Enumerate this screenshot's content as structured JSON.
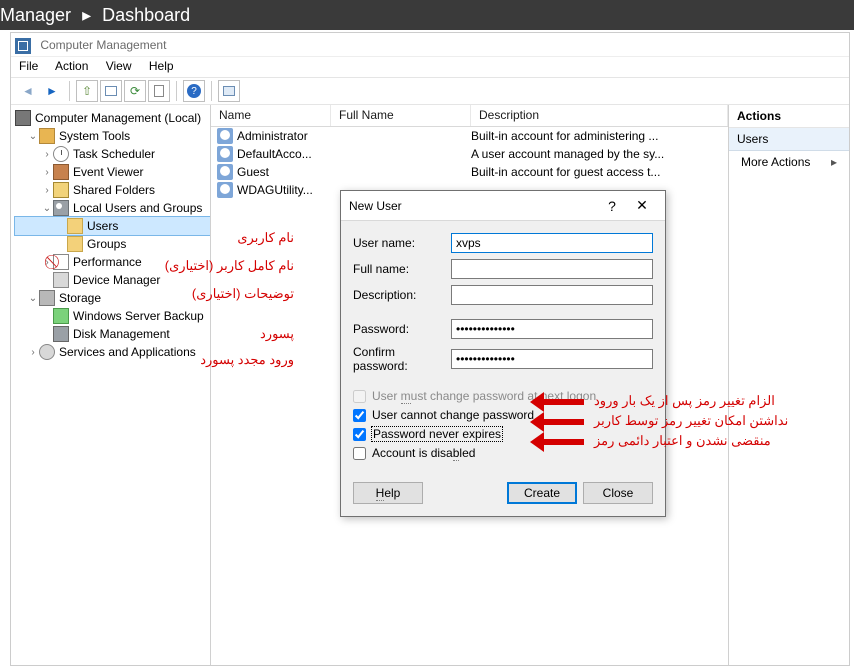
{
  "server_header": {
    "left": "Manager",
    "arrow": "▸",
    "right": "Dashboard"
  },
  "window": {
    "title": "Computer Management"
  },
  "menu": {
    "file": "File",
    "action": "Action",
    "view": "View",
    "help": "Help"
  },
  "tree": {
    "root": "Computer Management (Local)",
    "system_tools": "System Tools",
    "task_scheduler": "Task Scheduler",
    "event_viewer": "Event Viewer",
    "shared_folders": "Shared Folders",
    "lug": "Local Users and Groups",
    "users": "Users",
    "groups": "Groups",
    "performance": "Performance",
    "device_manager": "Device Manager",
    "storage": "Storage",
    "wsb": "Windows Server Backup",
    "disk_management": "Disk Management",
    "services": "Services and Applications"
  },
  "columns": {
    "name": "Name",
    "fullname": "Full Name",
    "description": "Description"
  },
  "users_list": [
    {
      "name": "Administrator",
      "fullname": "",
      "description": "Built-in account for administering ..."
    },
    {
      "name": "DefaultAcco...",
      "fullname": "",
      "description": "A user account managed by the sy..."
    },
    {
      "name": "Guest",
      "fullname": "",
      "description": "Built-in account for guest access t..."
    },
    {
      "name": "WDAGUtility...",
      "fullname": "",
      "description": ""
    }
  ],
  "actions": {
    "title": "Actions",
    "section": "Users",
    "more": "More Actions"
  },
  "dialog": {
    "title": "New User",
    "help_mark": "?",
    "close_mark": "✕",
    "labels": {
      "user": "User name:",
      "full": "Full name:",
      "desc": "Description:",
      "pw": "Password:",
      "cpw": "Confirm password:"
    },
    "values": {
      "user": "xvps",
      "full": "",
      "desc": "",
      "pw": "••••••••••••••",
      "cpw": "••••••••••••••"
    },
    "checks": {
      "mustchange_pre": "User ",
      "mustchange_u": "m",
      "mustchange_post": "ust change password at next logon",
      "cannot": "User cannot change password",
      "never": "Password never expires",
      "disabled_pre": "Account is disa",
      "disabled_u": "b",
      "disabled_post": "led"
    },
    "check_state": {
      "mustchange": false,
      "cannot": true,
      "never": true,
      "disabled": false
    },
    "buttons": {
      "help_pre": "",
      "help_u": "H",
      "help_post": "elp",
      "create": "Create",
      "close": "Close"
    }
  },
  "annotations": {
    "user": "نام کاربری",
    "full": "نام کامل کاربر (اختیاری)",
    "desc": "توضیحات (اختیاری)",
    "pw": "پسورد",
    "cpw": "ورود مجدد پسورد",
    "mustchange": "الزام تغییر رمز پس از یک بار ورود",
    "cannot": "نداشتن امکان تغییر رمز توسط کاربر",
    "never": "منقضی نشدن و اعتبار دائمی رمز"
  }
}
